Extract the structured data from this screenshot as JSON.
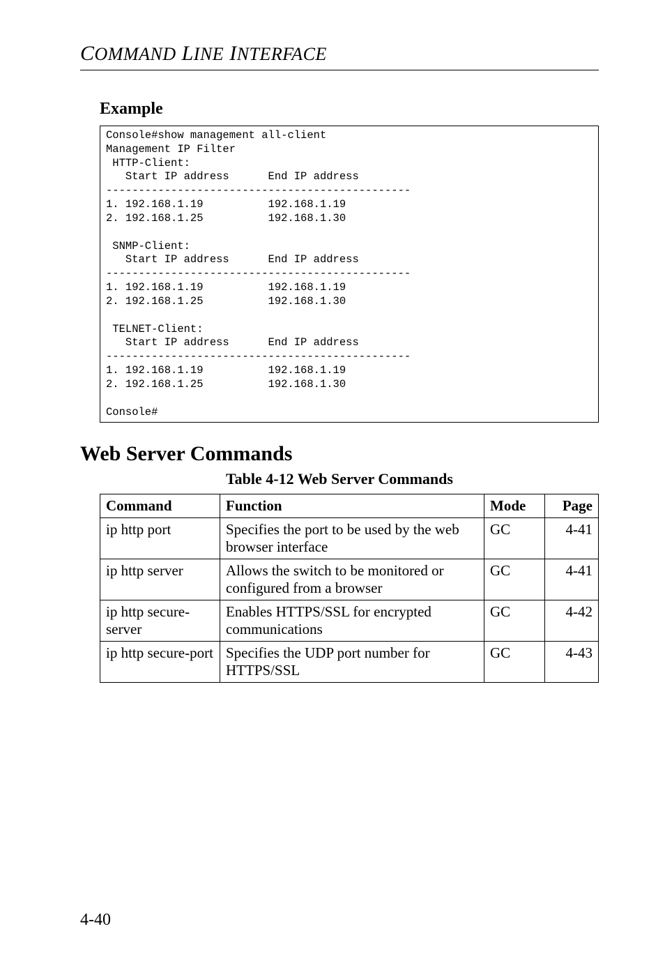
{
  "header": {
    "title_part1": "C",
    "title_part2": "OMMAND",
    "title_part3": " L",
    "title_part4": "INE",
    "title_part5": " I",
    "title_part6": "NTERFACE"
  },
  "example": {
    "label": "Example",
    "code": "Console#show management all-client\nManagement IP Filter\n HTTP-Client:\n   Start IP address      End IP address\n-----------------------------------------------\n1. 192.168.1.19          192.168.1.19\n2. 192.168.1.25          192.168.1.30\n\n SNMP-Client:\n   Start IP address      End IP address\n-----------------------------------------------\n1. 192.168.1.19          192.168.1.19\n2. 192.168.1.25          192.168.1.30\n\n TELNET-Client:\n   Start IP address      End IP address\n-----------------------------------------------\n1. 192.168.1.19          192.168.1.19\n2. 192.168.1.25          192.168.1.30\n\nConsole#"
  },
  "section": {
    "title": "Web Server Commands",
    "table_caption": "Table 4-12  Web Server Commands",
    "headers": {
      "command": "Command",
      "function": "Function",
      "mode": "Mode",
      "page": "Page"
    },
    "rows": [
      {
        "command": "ip http port",
        "function": "Specifies the port to be used by the web browser interface",
        "mode": "GC",
        "page": "4-41"
      },
      {
        "command": "ip http server",
        "function": "Allows the switch to be monitored or configured from a browser",
        "mode": "GC",
        "page": "4-41"
      },
      {
        "command": "ip http secure-server",
        "function": "Enables HTTPS/SSL for encrypted communications",
        "mode": "GC",
        "page": "4-42"
      },
      {
        "command": "ip http secure-port",
        "function": "Specifies the UDP port number for HTTPS/SSL",
        "mode": "GC",
        "page": "4-43"
      }
    ]
  },
  "page_number": "4-40"
}
